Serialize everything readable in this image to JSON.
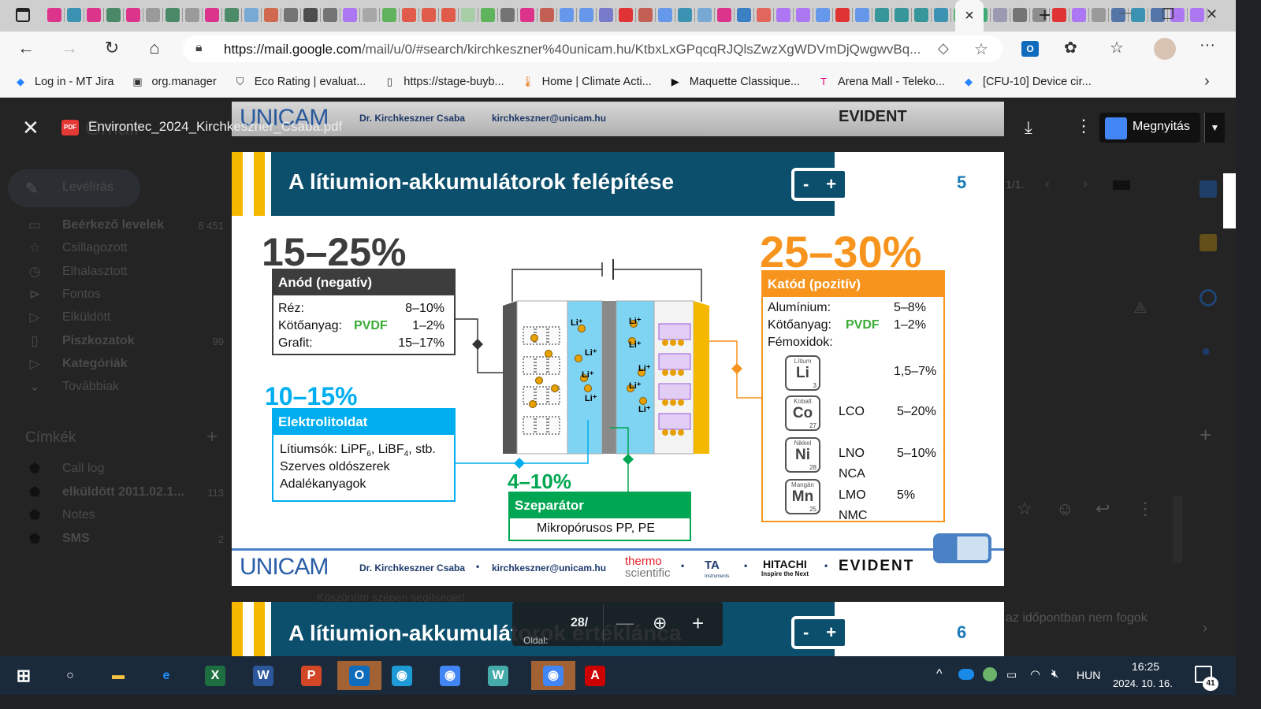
{
  "browser": {
    "active_tab_close": "×",
    "new_tab": "+",
    "url_host": "https://mail.google.com",
    "url_path": "/mail/u/0/#search/kirchkeszner%40unicam.hu/KtbxLxGPqcqRJQlsZwzXgWDVmDjQwgwvBq...",
    "tab_icons": [
      "R",
      "S",
      "T",
      "F",
      "T",
      "doc",
      "h",
      "doc",
      "T",
      "X",
      "globe",
      "P",
      "doc",
      "chart",
      "chart",
      "figma",
      "re",
      "crown",
      "V",
      "V",
      "V",
      "tego",
      "crown",
      "doc",
      "T",
      "Q",
      "d",
      "d",
      "m",
      "O",
      "f",
      "G",
      "S",
      "m",
      "T",
      "in",
      "M",
      "figma",
      "figma",
      "G",
      "O",
      "d",
      "F",
      "F",
      "F",
      "S",
      "drive",
      "+",
      "dc",
      "doc",
      "r",
      "O",
      "figma",
      "doc",
      "W",
      "S",
      "W",
      "figma",
      "figma"
    ],
    "window_controls": {
      "minimize": "—",
      "restore": "❐",
      "close": "✕"
    }
  },
  "bookmarks": [
    {
      "label": "Log in - MT Jira",
      "icon": "jira-diamond-icon",
      "color": "#2684ff"
    },
    {
      "label": "org.manager",
      "icon": "org-icon",
      "color": "#333"
    },
    {
      "label": "Eco Rating | evaluat...",
      "icon": "eco-shield-icon",
      "color": "#333"
    },
    {
      "label": "https://stage-buyb...",
      "icon": "page-icon",
      "color": "#333"
    },
    {
      "label": "Home | Climate Acti...",
      "icon": "thermometer-icon",
      "color": "#e67e22"
    },
    {
      "label": "Maquette Classique...",
      "icon": "play-icon",
      "color": "#111"
    },
    {
      "label": "Arena Mall - Teleko...",
      "icon": "telekom-icon",
      "color": "#e20074"
    },
    {
      "label": "[CFU-10] Device cir...",
      "icon": "jira-diamond-icon",
      "color": "#2684ff"
    }
  ],
  "gmail": {
    "app_name": "Gmail",
    "compose": "Levélírás",
    "nav": [
      {
        "label": "Beérkező levelek",
        "count": "8 451",
        "bold": true,
        "icon": "inbox-icon"
      },
      {
        "label": "Csillagozott",
        "count": "",
        "bold": false,
        "icon": "star-icon"
      },
      {
        "label": "Elhalasztott",
        "count": "",
        "bold": false,
        "icon": "clock-icon"
      },
      {
        "label": "Fontos",
        "count": "",
        "bold": false,
        "icon": "important-icon"
      },
      {
        "label": "Elküldött",
        "count": "",
        "bold": false,
        "icon": "send-icon"
      },
      {
        "label": "Piszkozatok",
        "count": "99",
        "bold": true,
        "icon": "draft-icon"
      },
      {
        "label": "Kategóriák",
        "count": "",
        "bold": true,
        "icon": "label-icon"
      },
      {
        "label": "Továbbiak",
        "count": "",
        "bold": false,
        "icon": "chevron-down-icon"
      }
    ],
    "labels_header": "Címkék",
    "labels": [
      {
        "label": "Call log",
        "count": "",
        "bold": false
      },
      {
        "label": "elküldött 2011.02.1...",
        "count": "113",
        "bold": true
      },
      {
        "label": "Notes",
        "count": "",
        "bold": false
      },
      {
        "label": "SMS",
        "count": "2",
        "bold": true
      }
    ],
    "pagination": "1/1.",
    "email_snippet_1": "Köszönöm szépen segítségét!",
    "email_snippet_2": "az időpontban nem fogok"
  },
  "pdf_viewer": {
    "filename": "Environtec_2024_Kirchkeszner_Csaba.pdf",
    "badge": "PDF",
    "open_with": "Megnyitás",
    "page_indicator": "28/",
    "page_label": "Oldal:",
    "zoom_out": "—",
    "zoom_in": "+"
  },
  "slide": {
    "title": "A lítiumion-akkumulátorok felépítése",
    "page": "5",
    "battery_label": "-  +",
    "anode": {
      "pct": "15–25%",
      "header": "Anód (negatív)",
      "rows": [
        {
          "name": "Réz:",
          "extra": "",
          "value": "8–10%"
        },
        {
          "name": "Kötőanyag:",
          "extra": "PVDF",
          "value": "1–2%"
        },
        {
          "name": "Grafit:",
          "extra": "",
          "value": "15–17%"
        }
      ]
    },
    "cathode": {
      "pct": "25–30%",
      "header": "Katód (pozitív)",
      "rows": [
        {
          "name": "Alumínium:",
          "extra": "",
          "value": "5–8%"
        },
        {
          "name": "Kötőanyag:",
          "extra": "PVDF",
          "value": "1–2%"
        },
        {
          "name": "Fémoxidok:",
          "extra": "",
          "value": ""
        }
      ],
      "elements": [
        {
          "name": "Lítium",
          "symbol": "Li",
          "z": "3",
          "types": "",
          "value": "1,5–7%"
        },
        {
          "name": "Kobalt",
          "symbol": "Co",
          "z": "27",
          "types": "LCO",
          "value": "5–20%"
        },
        {
          "name": "Nikkel",
          "symbol": "Ni",
          "z": "28",
          "types": "LNO\nNCA",
          "value": "5–10%"
        },
        {
          "name": "Mangán",
          "symbol": "Mn",
          "z": "25",
          "types": "LMO\nNMC",
          "value": "5%"
        }
      ]
    },
    "electrolyte": {
      "pct": "10–15%",
      "header": "Elektrolitoldat",
      "line1": "Lítiumsók: LiPF",
      "sub1": "6",
      "mid1": ", LiBF",
      "sub2": "4",
      "end1": ", stb.",
      "line2": "Szerves oldószerek",
      "line3": "Adalékanyagok"
    },
    "separator": {
      "pct": "4–10%",
      "header": "Szeparátor",
      "body": "Mikropórusos PP, PE"
    },
    "ion_label": "Li⁺",
    "footer": {
      "logo": "UNICAM",
      "author": "Dr. Kirchkeszner Csaba",
      "email": "kirchkeszner@unicam.hu",
      "sponsor1_a": "thermo",
      "sponsor1_b": "scientific",
      "sponsor2": "TA",
      "sponsor2_sub": "Instruments",
      "sponsor3": "HITACHI",
      "sponsor3_sub": "Inspire the Next",
      "sponsor4": "EVIDENT"
    },
    "colors": {
      "title_bg": "#0b4f6c",
      "anode": "#3d3d3d",
      "cathode": "#f7941d",
      "electrolyte": "#00aeef",
      "separator": "#00a651",
      "pvdf": "#3aaa35"
    }
  },
  "next_slide": {
    "title": "A lítiumion-akkumulátorok értéklánca",
    "page": "6"
  },
  "taskbar": {
    "apps": [
      "start",
      "search",
      "explorer",
      "ie",
      "excel",
      "word",
      "powerpoint",
      "outlook",
      "edge",
      "chrome",
      "webex",
      "chrome",
      "acrobat"
    ],
    "lang": "HUN",
    "time": "16:25",
    "date": "2024. 10. 16.",
    "notifications": "41"
  }
}
